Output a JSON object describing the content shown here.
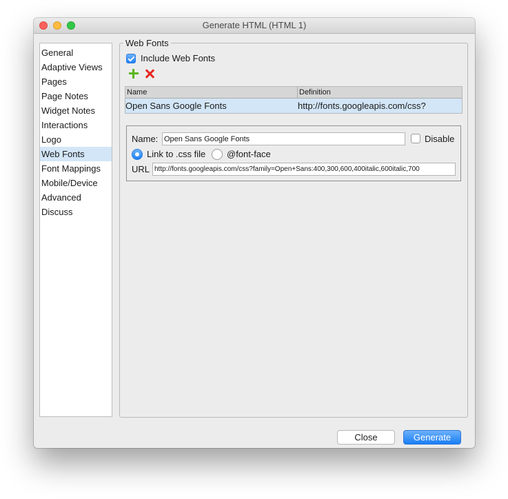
{
  "window": {
    "title": "Generate HTML (HTML 1)"
  },
  "sidebar": {
    "selected": "Web Fonts",
    "items": [
      {
        "label": "General"
      },
      {
        "label": "Adaptive Views"
      },
      {
        "label": "Pages"
      },
      {
        "label": "Page Notes"
      },
      {
        "label": "Widget Notes"
      },
      {
        "label": "Interactions"
      },
      {
        "label": "Logo"
      },
      {
        "label": "Web Fonts"
      },
      {
        "label": "Font Mappings"
      },
      {
        "label": "Mobile/Device"
      },
      {
        "label": "Advanced"
      },
      {
        "label": "Discuss"
      }
    ]
  },
  "web_fonts": {
    "group_label": "Web Fonts",
    "include_label": "Include Web Fonts",
    "include_checked": true,
    "add_icon": "plus-icon",
    "delete_icon": "x-icon",
    "table": {
      "columns": [
        "Name",
        "Definition"
      ],
      "rows": [
        {
          "name": "Open Sans Google Fonts",
          "definition": "http://fonts.googleapis.com/css?"
        }
      ]
    }
  },
  "details": {
    "name_label": "Name:",
    "name_value": "Open Sans Google Fonts",
    "disable_label": "Disable",
    "disable_checked": false,
    "link_css_label": "Link to .css file",
    "font_face_label": "@font-face",
    "selected_mode": "Link to .css file",
    "url_label": "URL",
    "url_value": "http://fonts.googleapis.com/css?family=Open+Sans:400,300,600,400italic,600italic,700"
  },
  "footer": {
    "close_label": "Close",
    "generate_label": "Generate"
  },
  "colors": {
    "accent": "#1e7ff7",
    "selection": "#d3e6f7",
    "add_green": "#5db61e",
    "delete_red": "#e8251f"
  }
}
